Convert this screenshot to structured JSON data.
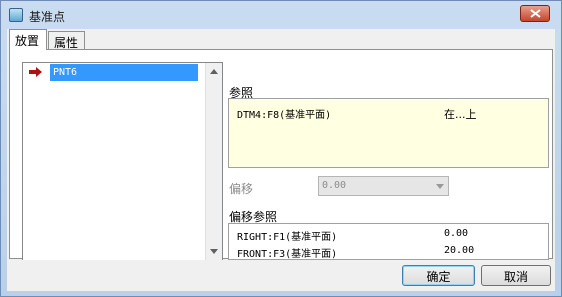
{
  "window": {
    "title": "基准点"
  },
  "tabs": [
    {
      "label": "放置"
    },
    {
      "label": "属性"
    }
  ],
  "point_list": {
    "items": [
      "PNT6"
    ]
  },
  "references": {
    "label": "参照",
    "rows": [
      {
        "ref": "DTM4:F8(基准平面)",
        "constraint": "在...上"
      }
    ]
  },
  "offset": {
    "label": "偏移",
    "value": "0.00"
  },
  "offset_references": {
    "label": "偏移参照",
    "rows": [
      {
        "ref": "RIGHT:F1(基准平面)",
        "value": "0.00"
      },
      {
        "ref": "FRONT:F3(基准平面)",
        "value": "20.00"
      }
    ]
  },
  "buttons": {
    "ok": "确定",
    "cancel": "取消"
  },
  "colors": {
    "selection": "#3399ff",
    "reference_bg": "#ffffe1"
  }
}
